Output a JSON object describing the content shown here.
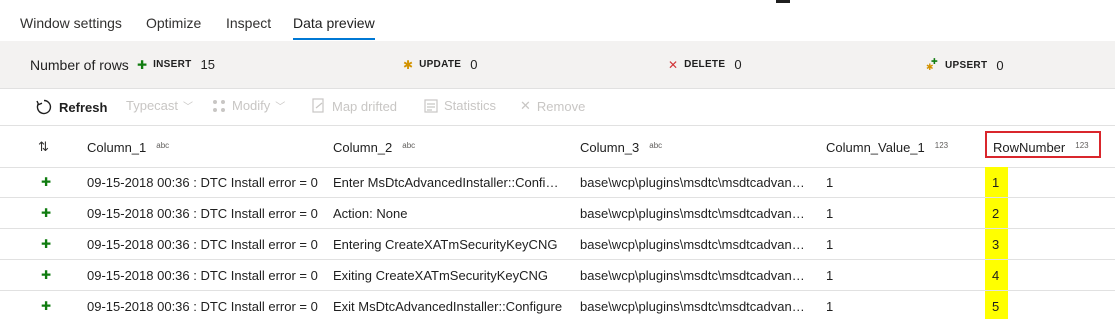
{
  "tabs": [
    {
      "label": "Window settings"
    },
    {
      "label": "Optimize"
    },
    {
      "label": "Inspect"
    },
    {
      "label": "Data preview",
      "active": true
    }
  ],
  "summary": {
    "label": "Number of rows",
    "stats": [
      {
        "icon": "plus-icon",
        "name": "INSERT",
        "value": "15",
        "color": "#107c10"
      },
      {
        "icon": "asterisk-icon",
        "name": "UPDATE",
        "value": "0",
        "color": "#d29200"
      },
      {
        "icon": "x-icon",
        "name": "DELETE",
        "value": "0",
        "color": "#d13438"
      },
      {
        "icon": "upsert-icon",
        "name": "UPSERT",
        "value": "0",
        "color": "#107c10"
      }
    ]
  },
  "toolbar": {
    "refresh": "Refresh",
    "typecast": "Typecast",
    "modify": "Modify",
    "map_drifted": "Map drifted",
    "statistics": "Statistics",
    "remove": "Remove"
  },
  "table": {
    "columns": [
      {
        "name": "Column_1",
        "type": "abc"
      },
      {
        "name": "Column_2",
        "type": "abc"
      },
      {
        "name": "Column_3",
        "type": "abc"
      },
      {
        "name": "Column_Value_1",
        "type": "123"
      },
      {
        "name": "RowNumber",
        "type": "123"
      }
    ],
    "rows": [
      [
        "09-15-2018 00:36 : DTC Install error = 0",
        "Enter MsDtcAdvancedInstaller::Configure",
        "base\\wcp\\plugins\\msdtc\\msdtcadvancedinstaller",
        "1",
        "1"
      ],
      [
        "09-15-2018 00:36 : DTC Install error = 0",
        "Action: None",
        "base\\wcp\\plugins\\msdtc\\msdtcadvancedinstaller",
        "1",
        "2"
      ],
      [
        "09-15-2018 00:36 : DTC Install error = 0",
        "Entering CreateXATmSecurityKeyCNG",
        "base\\wcp\\plugins\\msdtc\\msdtcadvancedinstaller",
        "1",
        "3"
      ],
      [
        "09-15-2018 00:36 : DTC Install error = 0",
        "Exiting CreateXATmSecurityKeyCNG",
        "base\\wcp\\plugins\\msdtc\\msdtcadvancedinstaller",
        "1",
        "4"
      ],
      [
        "09-15-2018 00:36 : DTC Install error = 0",
        "Exit MsDtcAdvancedInstaller::Configure",
        "base\\wcp\\plugins\\msdtc\\msdtcadvancedinstaller",
        "1",
        "5"
      ]
    ]
  },
  "colors": {
    "accent": "#0078d4",
    "highlight": "#ffff00",
    "callout": "#d9262c"
  }
}
